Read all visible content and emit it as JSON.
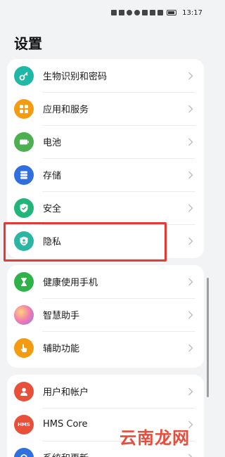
{
  "status_bar": {
    "time": "13:17",
    "icons": [
      "sim-icon",
      "signal-icon",
      "wifi-icon",
      "app-icon",
      "nfc-icon",
      "bluetooth-icon",
      "vibrate-icon",
      "battery-icon"
    ]
  },
  "page": {
    "title": "设置"
  },
  "groups": [
    {
      "items": [
        {
          "label": "生物识别和密码",
          "icon": "key-icon",
          "color": "#1fb8a6"
        },
        {
          "label": "应用和服务",
          "icon": "apps-icon",
          "color": "#f39c12"
        },
        {
          "label": "电池",
          "icon": "battery-icon",
          "color": "#4caf50"
        },
        {
          "label": "存储",
          "icon": "storage-icon",
          "color": "#2f6fe0"
        },
        {
          "label": "安全",
          "icon": "shield-icon",
          "color": "#22b57a"
        },
        {
          "label": "隐私",
          "icon": "privacy-icon",
          "color": "#2bb5a3"
        }
      ]
    },
    {
      "items": [
        {
          "label": "健康使用手机",
          "icon": "hourglass-icon",
          "color": "#2fb24a"
        },
        {
          "label": "智慧助手",
          "icon": "assistant-icon",
          "color": "#b07be0"
        },
        {
          "label": "辅助功能",
          "icon": "hand-icon",
          "color": "#f39c12"
        }
      ]
    },
    {
      "items": [
        {
          "label": "用户和帐户",
          "icon": "user-icon",
          "color": "#e8503a"
        },
        {
          "label": "HMS Core",
          "icon": "hms-icon",
          "color": "#e8503a",
          "badge": "HMS"
        },
        {
          "label": "系统和更新",
          "icon": "system-icon",
          "color": "#2f6fe0"
        }
      ]
    }
  ],
  "watermark": "云南龙网",
  "colors": {
    "highlight": "#e53935",
    "background": "#f1f3f5"
  }
}
